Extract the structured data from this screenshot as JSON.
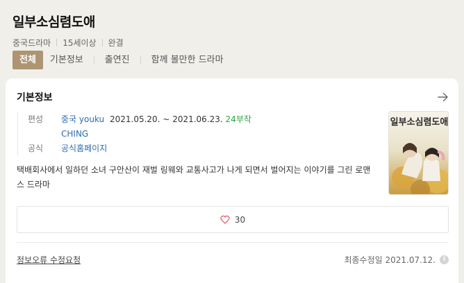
{
  "header": {
    "title": "일부소심렴도애",
    "meta": [
      "중국드라마",
      "15세이상",
      "완결"
    ]
  },
  "tabs": [
    {
      "label": "전체",
      "active": true
    },
    {
      "label": "기본정보",
      "active": false
    },
    {
      "label": "출연진",
      "active": false
    },
    {
      "label": "함께 볼만한 드라마",
      "active": false
    }
  ],
  "card": {
    "title": "기본정보",
    "arrow_icon": "arrow-right-icon",
    "info": {
      "row1_label": "편성",
      "country": "중국",
      "channel": "youku",
      "period": "2021.05.20. ~ 2021.06.23.",
      "episodes": "24부작",
      "channel2": "CHING",
      "row2_label": "공식",
      "homepage": "공식홈페이지"
    },
    "description": "택배회사에서 일하던 소녀 구안산이 재벌 링웨와 교통사고가 나게 되면서 벌어지는 이야기를 그린 로맨스 드라마",
    "poster": {
      "title_text": "일부소심렴도애"
    },
    "like": {
      "icon": "heart-icon",
      "count": "30"
    },
    "footer": {
      "report_label": "정보오류 수정요청",
      "updated_label": "최종수정일 2021.07.12.",
      "info_icon": "info-icon",
      "info_glyph": "i"
    }
  },
  "colors": {
    "active_tab": "#ad9472",
    "link_blue": "#2b6cb0",
    "episodes_green": "#2ea043",
    "background": "#f1efea"
  }
}
